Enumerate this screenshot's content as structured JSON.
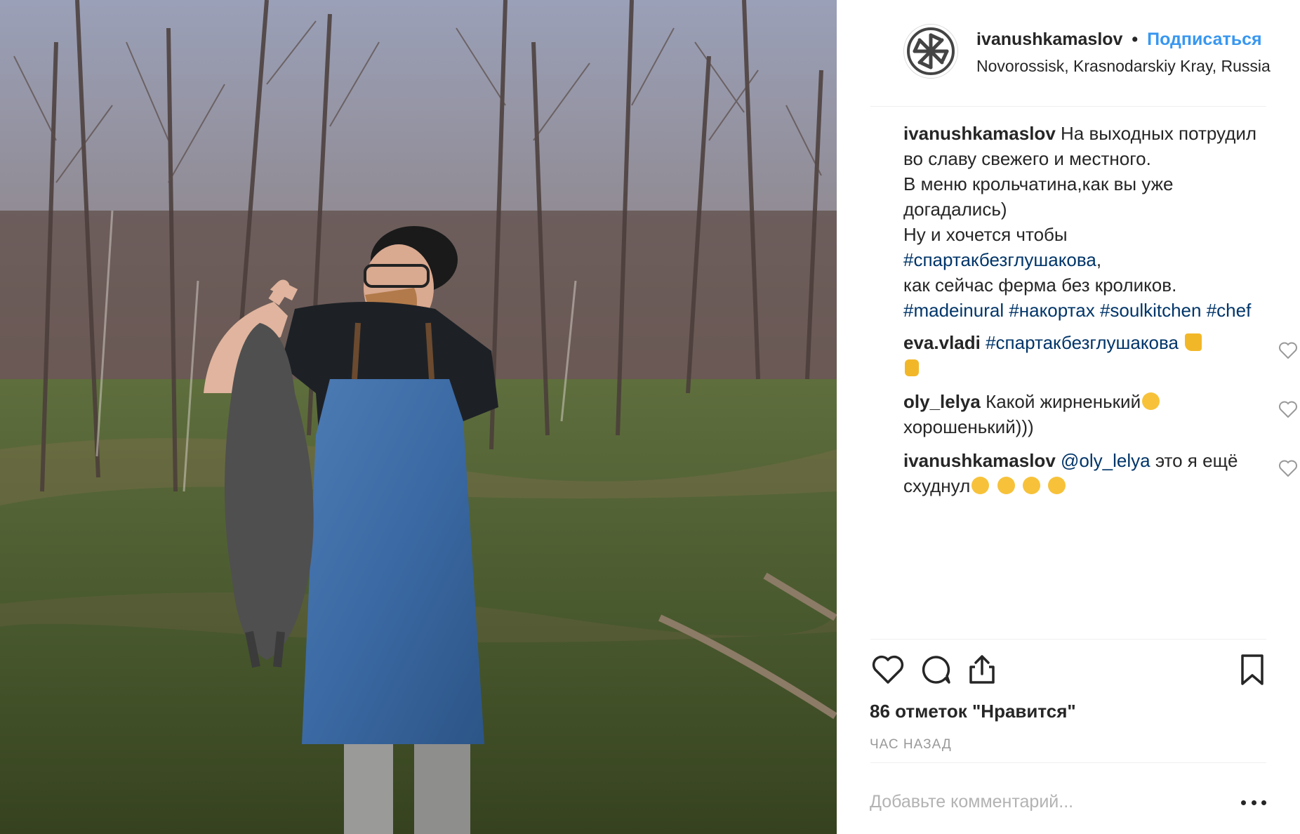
{
  "post": {
    "username": "ivanushkamaslov",
    "dot": "•",
    "follow_label": "Подписаться",
    "location": "Novorossisk, Krasnodarskiy Kray, Russia",
    "avatar_icon": "kolovrat-symbol-icon"
  },
  "caption": {
    "username": "ivanushkamaslov",
    "line1": "На выходных потрудил",
    "line2": "во славу свежего и местного.",
    "line3": "В меню крольчатина,как вы уже",
    "line4": "догадались)",
    "line5": "Ну и хочется чтобы",
    "hashtag1": "#спартакбезглушакова",
    "comma": ",",
    "line7": "как сейчас ферма без кроликов.",
    "hashtags": [
      "#madeinural",
      "#накортах",
      "#soulkitchen",
      "#chef"
    ]
  },
  "comments": [
    {
      "username": "eva.vladi",
      "hashtag": "#спартакбезглушакова",
      "emojis": [
        "thumbs-up-emoji",
        "ok-hand-emoji"
      ]
    },
    {
      "username": "oly_lelya",
      "text": "Какой жирненький",
      "text2": "хорошенький)))",
      "emojis": [
        "smiling-face-emoji"
      ]
    },
    {
      "username": "ivanushkamaslov",
      "mention": "@oly_lelya",
      "text": "это я ещё",
      "text2": "схуднул",
      "emojis": [
        "joy-emoji",
        "rofl-emoji",
        "joy-emoji",
        "rofl-emoji"
      ]
    }
  ],
  "actions": {
    "like_icon": "heart-icon",
    "comment_icon": "comment-icon",
    "share_icon": "share-icon",
    "save_icon": "bookmark-icon"
  },
  "likes_text": "86 отметок \"Нравится\"",
  "time_text": "ЧАС НАЗАД",
  "add_comment_placeholder": "Добавьте комментарий...",
  "colors": {
    "link": "#3897f0",
    "hashtag": "#003569",
    "muted": "#999999",
    "text": "#262626"
  }
}
